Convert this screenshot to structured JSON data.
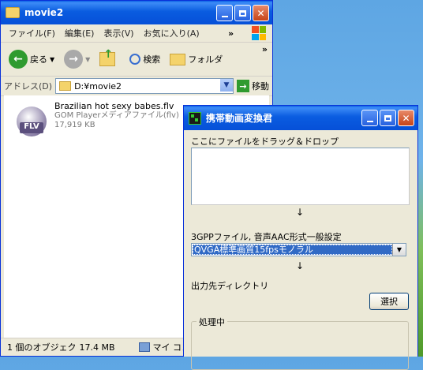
{
  "explorer": {
    "title": "movie2",
    "menus": [
      "ファイル(F)",
      "編集(E)",
      "表示(V)",
      "お気に入り(A)"
    ],
    "menu_overflow": "»",
    "toolbar": {
      "back_label": "戻る",
      "search_label": "検索",
      "folders_label": "フォルダ",
      "overflow": "»"
    },
    "address": {
      "label": "アドレス(D)",
      "value": "D:¥movie2",
      "go_label": "移動"
    },
    "file": {
      "icon_text": "FLV",
      "name": "Brazilian hot sexy babes.flv",
      "type": "GOM Playerメディアファイル(flv)",
      "size": "17,919 KB"
    },
    "status": {
      "objects": "1 個のオブジェク",
      "size": "17.4 MB",
      "location": "マイ コンピ"
    }
  },
  "converter": {
    "title": "携帯動画変換君",
    "drop_label": "ここにファイルをドラッグ＆ドロップ",
    "arrow": "↓",
    "setting_label": "3GPPファイル, 音声AAC形式一般設定",
    "preset_value": "QVGA標準画質15fpsモノラル",
    "output_label": "出力先ディレクトリ",
    "select_button": "選択",
    "processing_label": "処理中"
  },
  "colors": {
    "xp_blue": "#0a5ce0",
    "selection_blue": "#316ac5",
    "close_red": "#c74418"
  }
}
